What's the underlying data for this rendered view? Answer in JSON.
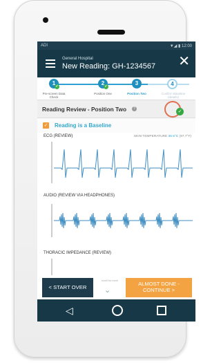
{
  "status": {
    "left": "ADI",
    "right": "▼◢ ▮ 12:00"
  },
  "header": {
    "hospital": "General Hospital",
    "title": "New Reading: GH-1234567"
  },
  "steps": [
    {
      "number": "1",
      "label": "Pre-screen Data Check"
    },
    {
      "number": "2",
      "label": "Position One"
    },
    {
      "number": "3",
      "label": "Position Two"
    },
    {
      "number": "4",
      "label": "Confirm Baseline (details)"
    }
  ],
  "review": {
    "title": "Reading Review - Position Two",
    "help_icon": "question-circle-icon"
  },
  "baseline": {
    "label": "Reading is a Baseline"
  },
  "ecg": {
    "label": "ECG (REVIEW)",
    "skin_prefix": "SKIN TEMPERATURE",
    "skin_value": "36.5°C",
    "skin_suffix": "(97.7°F)"
  },
  "audio": {
    "label": "AUDIO (REVIEW VIA HEADPHONES)"
  },
  "thoracic": {
    "label": "THORACIC IMPEDANCE (REVIEW)"
  },
  "actions": {
    "start_over": "< START OVER",
    "scroll_text": "scroll for more",
    "almost_done": "ALMOST DONE - CONTINUE >"
  },
  "colors": {
    "navy": "#163847",
    "accent": "#2ba0d0",
    "orange": "#f4a342",
    "green": "#38a845"
  }
}
